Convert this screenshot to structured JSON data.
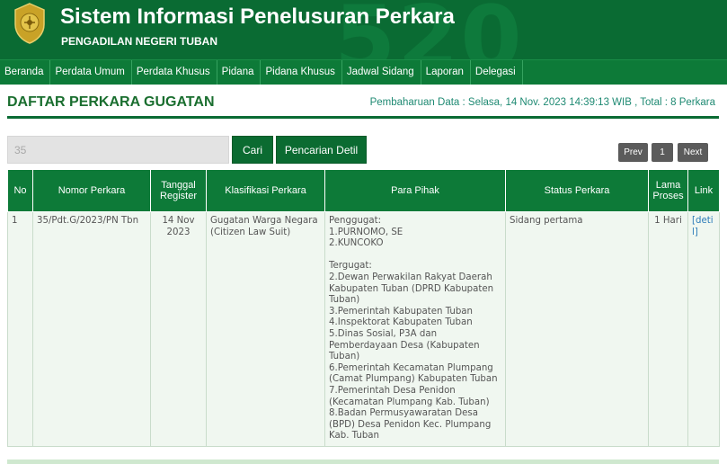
{
  "header": {
    "title": "Sistem Informasi Penelusuran Perkara",
    "subtitle": "PENGADILAN NEGERI TUBAN",
    "bg_number": "520",
    "logo_icon": "mahkamah-agung-emblem",
    "color": "#0a6b33"
  },
  "nav": {
    "items": [
      "Beranda",
      "Perdata Umum",
      "Perdata Khusus",
      "Pidana",
      "Pidana Khusus",
      "Jadwal Sidang",
      "Laporan",
      "Delegasi"
    ]
  },
  "page": {
    "title": "DAFTAR PERKARA GUGATAN",
    "update_info": "Pembaharuan Data : Selasa, 14 Nov. 2023 14:39:13 WIB , Total : 8 Perkara"
  },
  "search": {
    "value": "35",
    "cari_label": "Cari",
    "detil_label": "Pencarian Detil"
  },
  "pagination": {
    "prev": "Prev",
    "page": "1",
    "next": "Next"
  },
  "table": {
    "headers": [
      "No",
      "Nomor Perkara",
      "Tanggal Register",
      "Klasifikasi Perkara",
      "Para Pihak",
      "Status Perkara",
      "Lama Proses",
      "Link"
    ],
    "rows": [
      {
        "no": "1",
        "nomor": "35/Pdt.G/2023/PN Tbn",
        "tanggal": "14 Nov 2023",
        "klasifikasi": "Gugatan Warga Negara (Citizen Law Suit)",
        "pihak": "Penggugat:\n1.PURNOMO, SE\n2.KUNCOKO\n\nTergugat:\n2.Dewan Perwakilan Rakyat Daerah Kabupaten Tuban (DPRD Kabupaten Tuban)\n3.Pemerintah Kabupaten Tuban\n4.Inspektorat Kabupaten Tuban\n5.Dinas Sosial, P3A dan Pemberdayaan Desa (Kabupaten Tuban)\n6.Pemerintah Kecamatan Plumpang (Camat Plumpang) Kabupaten Tuban\n7.Pemerintah Desa Penidon (Kecamatan Plumpang Kab. Tuban)\n8.Badan Permusyawaratan Desa (BPD) Desa Penidon Kec. Plumpang Kab. Tuban",
        "status": "Sidang pertama",
        "lama": "1 Hari",
        "link": "[detil]"
      }
    ]
  }
}
